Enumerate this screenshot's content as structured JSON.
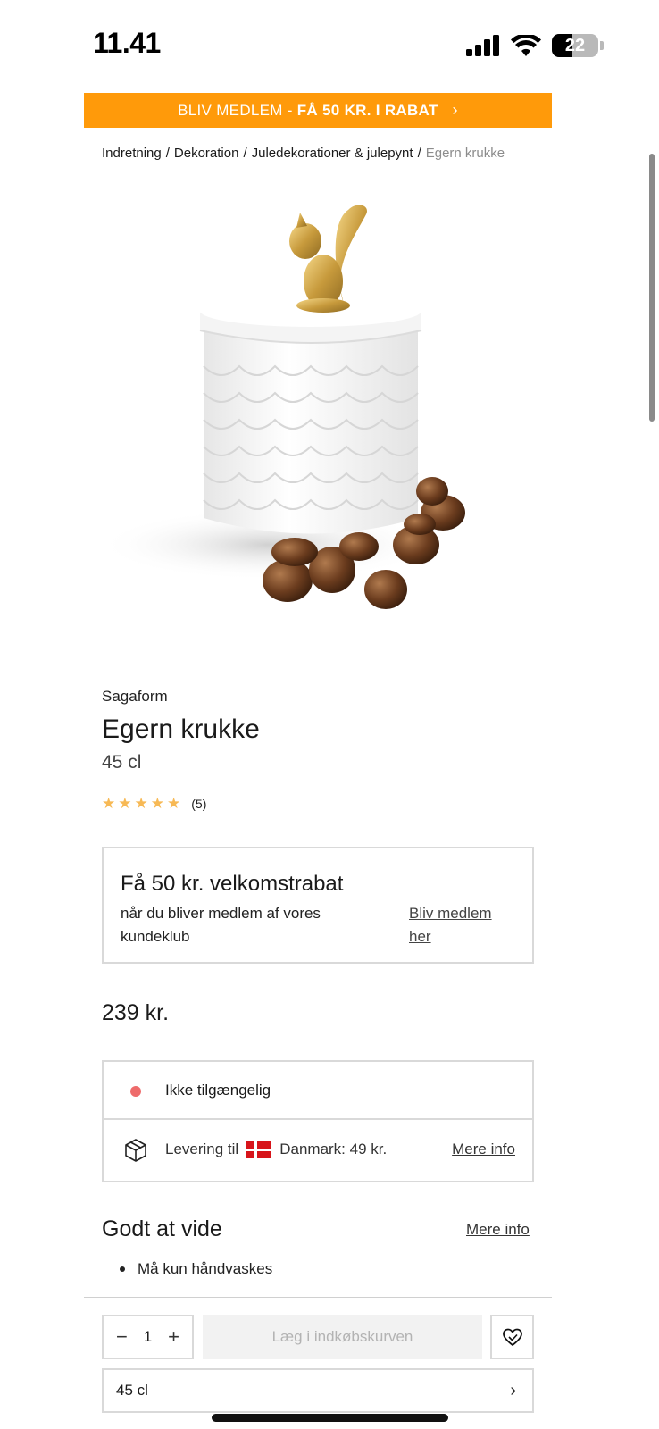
{
  "status_bar": {
    "time": "11.41",
    "battery": "22",
    "icons": [
      "signal-icon",
      "wifi-icon",
      "battery-icon"
    ]
  },
  "promo": {
    "prefix": "BLIV MEDLEM -",
    "highlight": "FÅ 50 KR. I RABAT",
    "chevron": "›"
  },
  "breadcrumb": {
    "items": [
      "Indretning",
      "Dekoration",
      "Juledekorationer & julepynt"
    ],
    "separator": "/",
    "current": "Egern krukke"
  },
  "product": {
    "brand": "Sagaform",
    "title": "Egern krukke",
    "size": "45 cl",
    "rating": {
      "stars": 5,
      "max": 5,
      "count": "(5)"
    },
    "price": "239 kr."
  },
  "membership": {
    "title": "Få 50 kr. velkomstrabat",
    "text": "når du bliver medlem af vores kundeklub",
    "link": "Bliv medlem her"
  },
  "availability": {
    "status": "Ikke tilgængelig",
    "status_color": "#ee6b6b",
    "delivery_prefix": "Levering til",
    "delivery_country": "Danmark: 49 kr.",
    "more_info": "Mere info"
  },
  "good_to_know": {
    "title": "Godt at vide",
    "more_info": "Mere info",
    "items": [
      "Må kun håndvaskes"
    ]
  },
  "purchase": {
    "quantity": "1",
    "minus": "−",
    "plus": "+",
    "add_to_cart": "Læg i indkøbskurven",
    "variant": "45 cl"
  },
  "colors": {
    "accent": "#ff9a0a",
    "star": "#f7b955"
  }
}
